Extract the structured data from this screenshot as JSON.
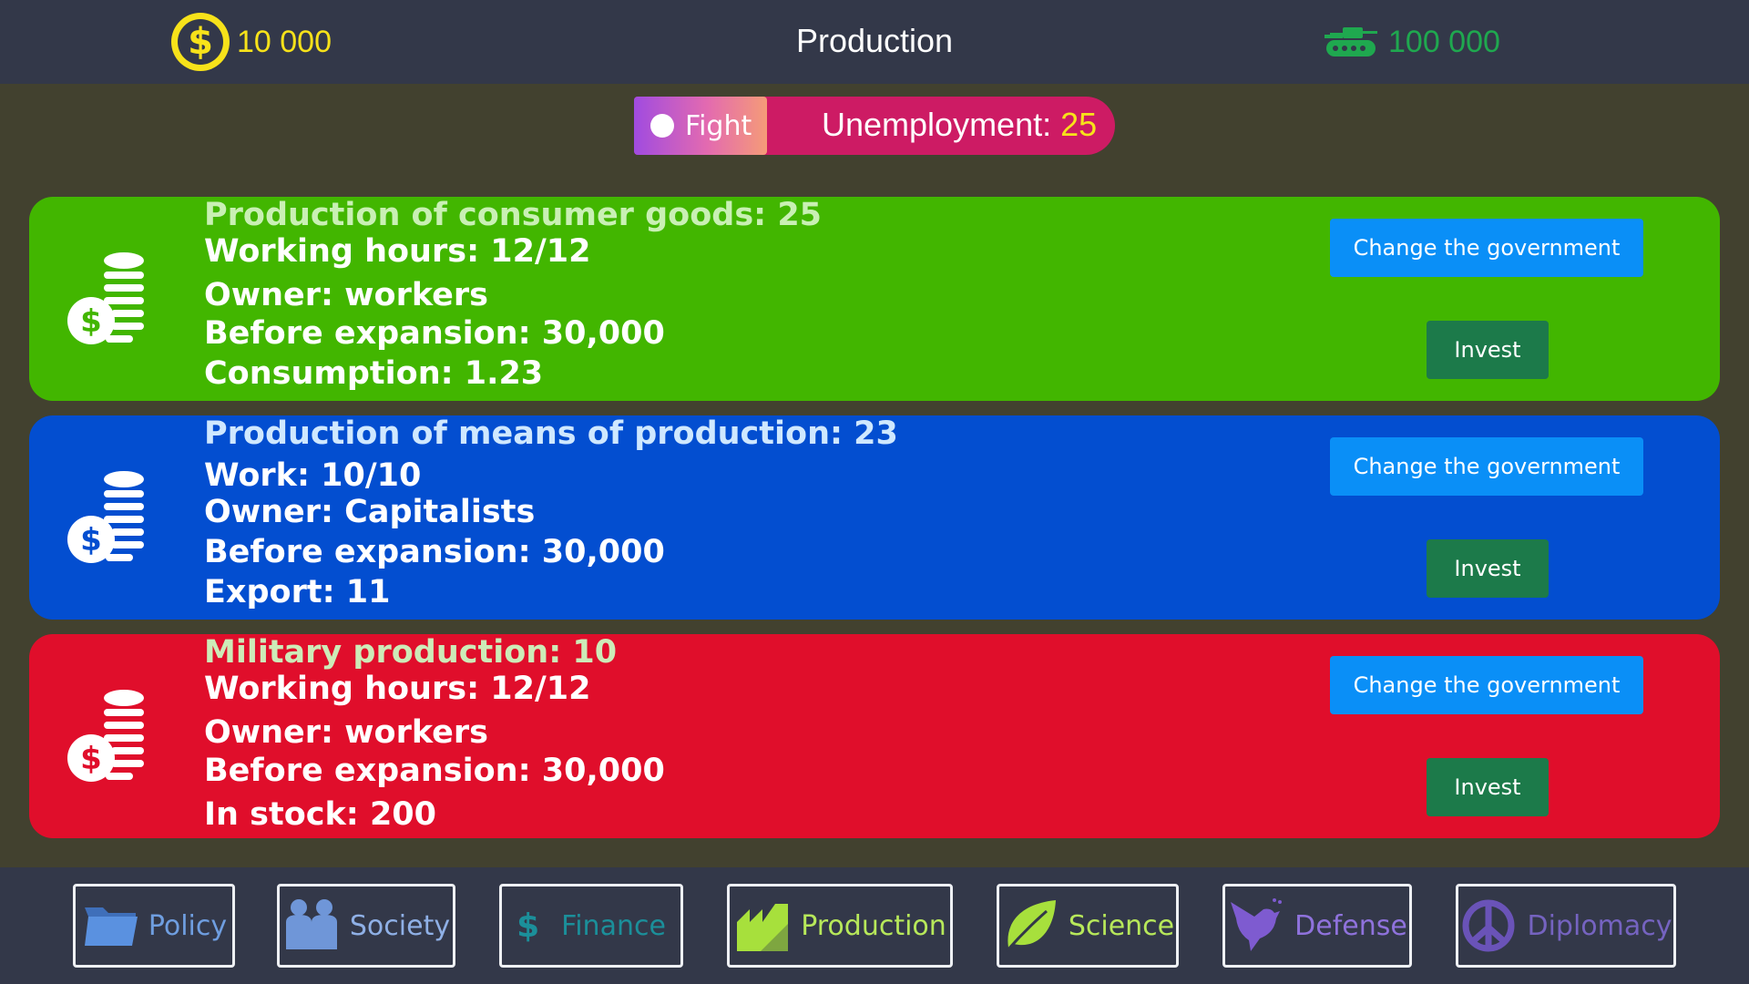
{
  "header": {
    "money": "10 000",
    "title": "Production",
    "army": "100 000"
  },
  "status": {
    "fight_label": "Fight",
    "unemployment_label": "Unemployment:",
    "unemployment_value": "25"
  },
  "cards": [
    {
      "color": "#42b600",
      "title": "Production of consumer goods: 25",
      "lines": [
        "Working hours: 12/12",
        "Owner: workers",
        "Before expansion: 30,000",
        "Consumption: 1.23"
      ],
      "gov_button": "Change the government",
      "invest_button": "Invest"
    },
    {
      "color": "#034ed0",
      "title": "Production of means of production: 23",
      "lines": [
        "Work: 10/10",
        "Owner: Capitalists",
        "Before expansion: 30,000",
        "Export: 11"
      ],
      "gov_button": "Change the government",
      "invest_button": "Invest"
    },
    {
      "color": "#e00e2b",
      "title": "Military production: 10",
      "lines": [
        "Working hours: 12/12",
        "Owner: workers",
        "Before expansion: 30,000",
        "In stock: 200"
      ],
      "gov_button": "Change the government",
      "invest_button": "Invest"
    }
  ],
  "nav": [
    {
      "label": "Policy",
      "icon": "folder-icon",
      "color": "#4f86d8"
    },
    {
      "label": "Society",
      "icon": "people-icon",
      "color": "#6f96d8"
    },
    {
      "label": "Finance",
      "icon": "dollar-icon",
      "color": "#1b8f9a"
    },
    {
      "label": "Production",
      "icon": "factory-icon",
      "color": "#a7e03c"
    },
    {
      "label": "Science",
      "icon": "leaf-icon",
      "color": "#a7e03c"
    },
    {
      "label": "Defense",
      "icon": "dove-icon",
      "color": "#7e5bd0"
    },
    {
      "label": "Diplomacy",
      "icon": "peace-icon",
      "color": "#6a53b8"
    }
  ],
  "colors": {
    "money": "#f7e21a",
    "army": "#1fa84f",
    "topbar": "#333849",
    "background": "#42412f"
  }
}
